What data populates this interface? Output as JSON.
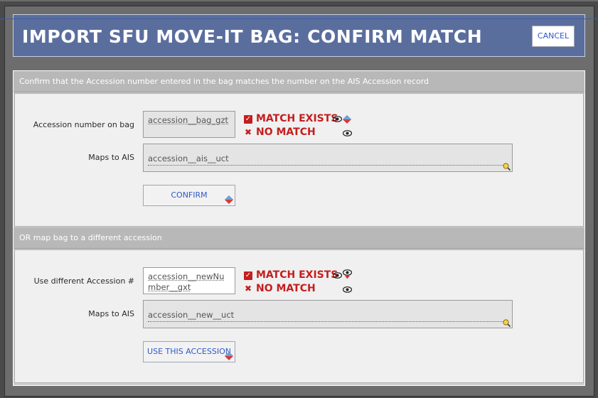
{
  "dialog": {
    "title": "IMPORT SFU MOVE-IT BAG: CONFIRM MATCH",
    "cancel_label": "CANCEL"
  },
  "section1": {
    "heading": "Confirm that the Accession number entered in the bag matches the number on the AIS Accession record",
    "bag_label": "Accession number on bag",
    "bag_value": "accession__bag_gzt",
    "match_exists": "MATCH EXISTS",
    "no_match": "NO MATCH",
    "maps_label": "Maps to AIS",
    "maps_value": "accession__ais__uct",
    "confirm_label": "CONFIRM"
  },
  "section2": {
    "heading": "OR map bag to a different accession",
    "use_label": "Use different Accession #",
    "use_value": "accession__newNumber__gxt",
    "match_exists": "MATCH EXISTS",
    "no_match": "NO MATCH",
    "maps_label": "Maps to AIS",
    "maps_value": "accession__new__uct",
    "use_button_label": "USE THIS ACCESSION"
  },
  "icons": {
    "eye": "eye-icon",
    "magnifier": "magnifier-icon",
    "diamond": "diamond-icon",
    "check": "check-icon",
    "x": "x-icon"
  },
  "colors": {
    "header_bg": "#5a6e9e",
    "match_red": "#c41e1e",
    "button_text": "#2e59c9",
    "section_head": "#b8b8b8"
  }
}
